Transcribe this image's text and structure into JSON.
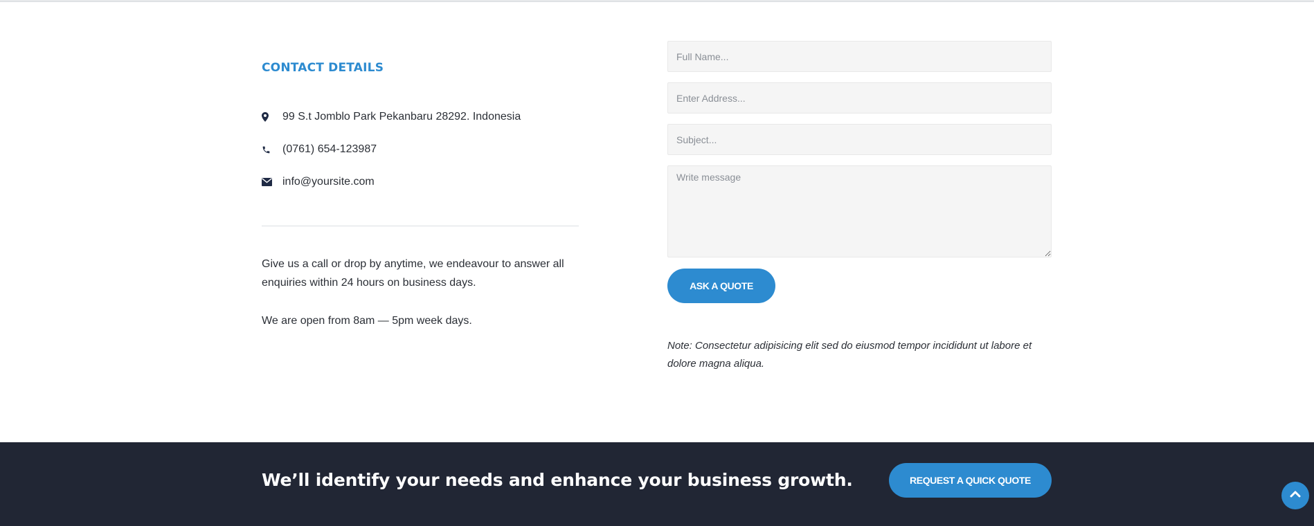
{
  "contact": {
    "title": "CONTACT DETAILS",
    "address": "99 S.t Jomblo Park Pekanbaru 28292. Indonesia",
    "phone": "(0761) 654-123987",
    "email": "info@yoursite.com",
    "paragraph_1": "Give us a call or drop by anytime, we endeavour to answer all enquiries within 24 hours on business days.",
    "paragraph_2": "We are open from 8am — 5pm week days.",
    "icons": {
      "address": "map-marker-icon",
      "phone": "phone-icon",
      "email": "envelope-icon"
    }
  },
  "form": {
    "full_name_placeholder": "Full Name...",
    "address_placeholder": "Enter Address...",
    "subject_placeholder": "Subject...",
    "message_placeholder": "Write message",
    "submit_label": "ASK A QUOTE",
    "note": "Note: Consectetur adipisicing elit sed do eiusmod tempor incididunt ut labore et dolore magna aliqua."
  },
  "cta": {
    "text": "We’ll identify your needs and enhance your business growth.",
    "button_label": "REQUEST A QUICK QUOTE"
  },
  "scroll_top": {
    "icon": "chevron-up-icon"
  },
  "colors": {
    "accent": "#2d8bd0",
    "dark_band": "#212634",
    "field_bg": "#f5f5f5",
    "text": "#2b2f36"
  }
}
